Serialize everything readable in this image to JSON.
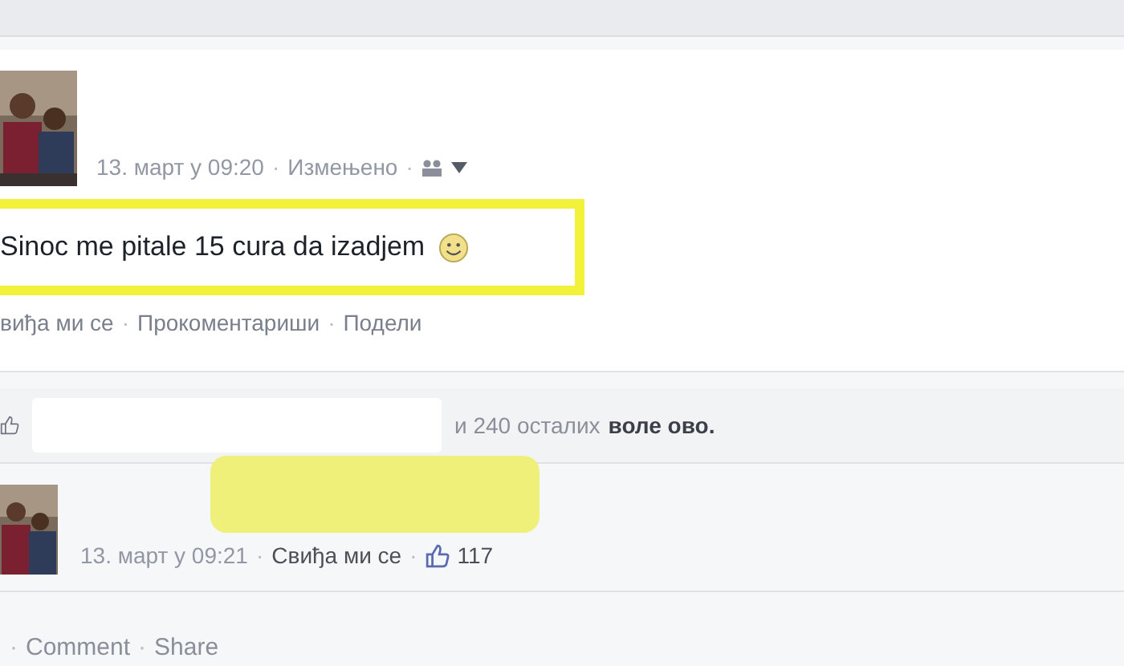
{
  "post": {
    "time": "13. март у 09:20",
    "separator": "·",
    "edited": "Измењено",
    "text": "Sinoc me pitale 15 cura da izadjem",
    "actions": [
      "виђа ми се",
      "Прокоментариши",
      "Подели"
    ]
  },
  "likes": {
    "count_text": "и 240 осталих",
    "suffix": "воле ово."
  },
  "comment": {
    "time": "13. март у 09:21",
    "like_link": "Свиђа ми се",
    "like_count": "117"
  },
  "footer_actions": [
    "Comment",
    "Share"
  ]
}
